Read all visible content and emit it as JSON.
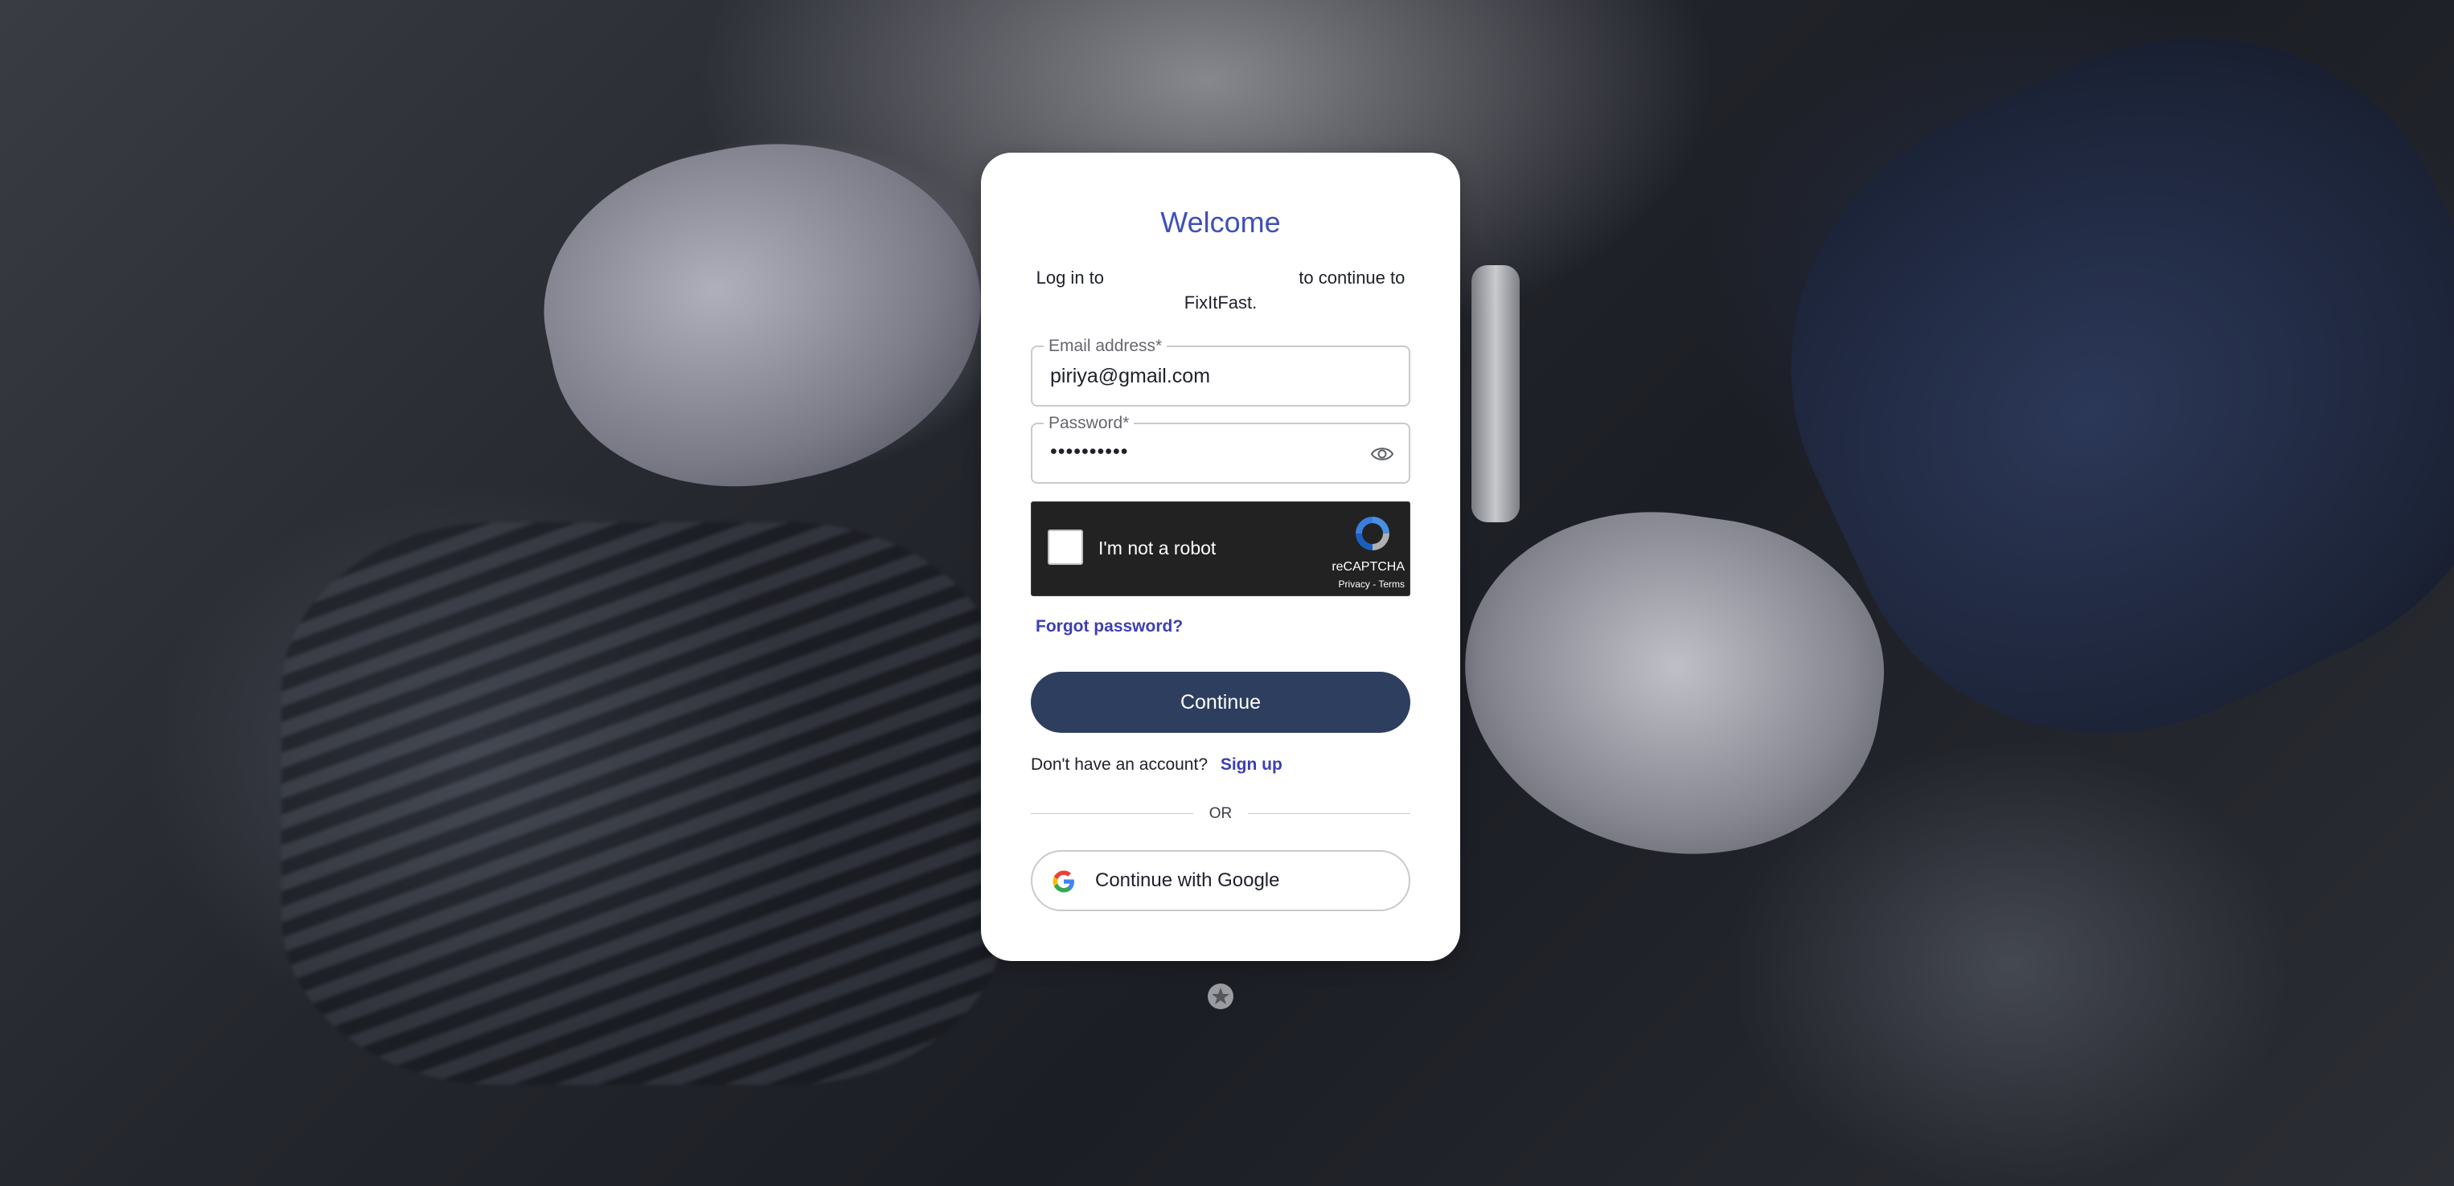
{
  "login": {
    "title": "Welcome",
    "subtitle_prefix": "Log in to",
    "subtitle_suffix": "to continue to FixItFast.",
    "email": {
      "label": "Email address*",
      "value": "piriya@gmail.com"
    },
    "password": {
      "label": "Password*",
      "value": "••••••••••"
    },
    "recaptcha": {
      "checkbox_label": "I'm not a robot",
      "brand": "reCAPTCHA",
      "links": "Privacy - Terms"
    },
    "forgot_password": "Forgot password?",
    "continue_button": "Continue",
    "signup_prompt": "Don't have an account?",
    "signup_link": "Sign up",
    "divider_text": "OR",
    "google_button": "Continue with Google"
  },
  "icons": {
    "show_password": "eye-icon",
    "google": "google-icon",
    "recaptcha": "recaptcha-icon",
    "footer": "star-badge-icon"
  },
  "colors": {
    "accent": "#3f51b5",
    "link": "#3d3fb0",
    "primary_button": "#2e3e5e",
    "captcha_bg": "#222222"
  }
}
